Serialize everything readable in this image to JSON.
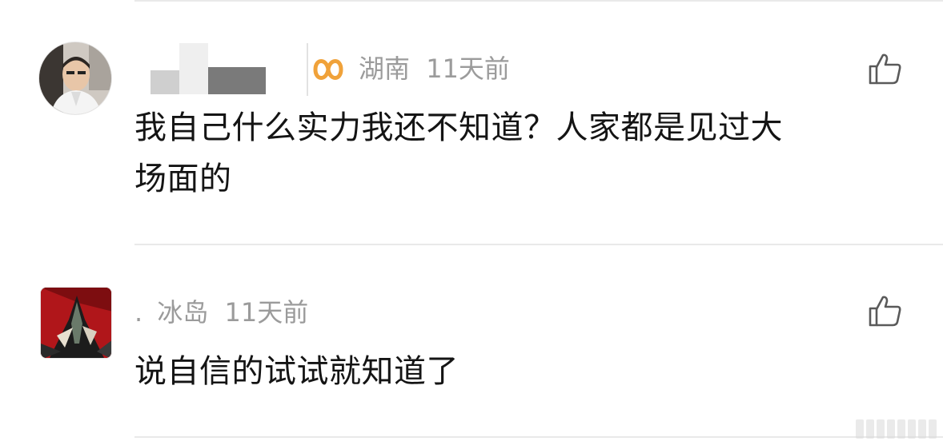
{
  "comments": [
    {
      "location": "湖南",
      "time": "11天前",
      "text": "我自己什么实力我还不知道？人家都是见过大场面的",
      "text_line1": "我自己什么实力我还不知道？人家都是见过大",
      "text_line2": "场面的"
    },
    {
      "username": ".",
      "location": "冰岛",
      "time": "11天前",
      "text": "说自信的试试就知道了"
    }
  ],
  "icons": {
    "like": "thumbs-up-icon",
    "badge": "infinity-badge-icon"
  },
  "colors": {
    "meta": "#9b9b9b",
    "body_text": "#141414",
    "badge": "#f0a23a",
    "divider": "#e9e9e9",
    "background": "#ffffff"
  }
}
